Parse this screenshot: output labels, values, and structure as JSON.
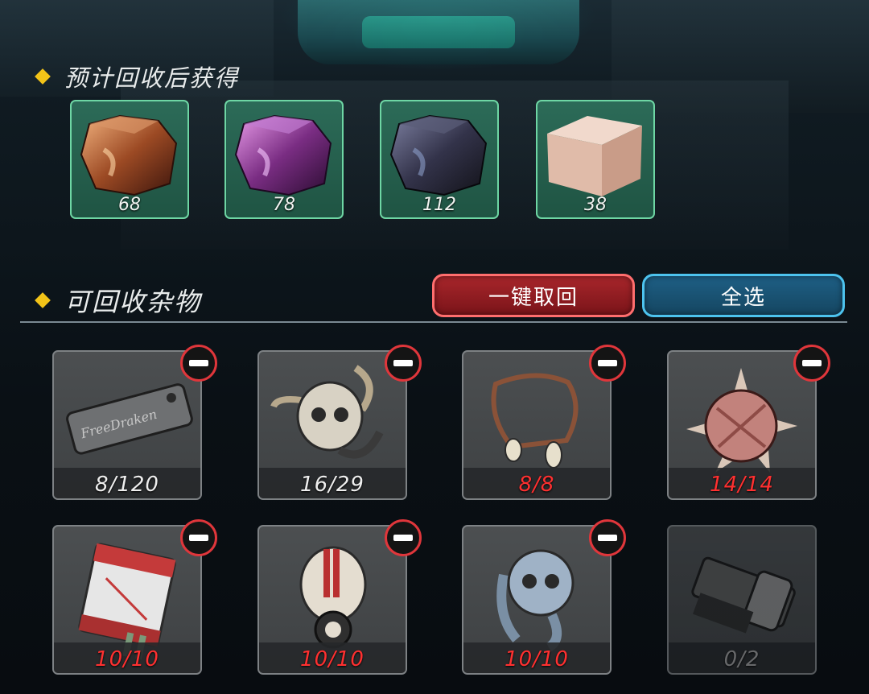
{
  "recycle_rewards": {
    "title": "预计回收后获得",
    "items": [
      {
        "icon": "copper-ore-icon",
        "count": "68"
      },
      {
        "icon": "purple-ore-icon",
        "count": "78"
      },
      {
        "icon": "dark-ore-icon",
        "count": "112"
      },
      {
        "icon": "stone-block-icon",
        "count": "38"
      }
    ]
  },
  "recyclables": {
    "title": "可回收杂物",
    "withdraw_all_label": "一键取回",
    "select_all_label": "全选",
    "items": [
      {
        "icon": "engraved-tag-icon",
        "count": "8/120",
        "full": false
      },
      {
        "icon": "horned-skull-icon",
        "count": "16/29",
        "full": false
      },
      {
        "icon": "bone-necklace-icon",
        "count": "8/8",
        "full": true
      },
      {
        "icon": "spiked-ball-icon",
        "count": "14/14",
        "full": true
      },
      {
        "icon": "battery-cell-icon",
        "count": "10/10",
        "full": true
      },
      {
        "icon": "gas-mask-icon",
        "count": "10/10",
        "full": true
      },
      {
        "icon": "skull-ring-icon",
        "count": "10/10",
        "full": true
      },
      {
        "icon": "mechanical-part-icon",
        "count": "0/2",
        "full": false
      }
    ]
  },
  "colors": {
    "accent_diamond": "#f2c318",
    "count_full": "#ff3030",
    "count_normal": "#eeeeee",
    "count_empty": "#9a9a9a"
  }
}
